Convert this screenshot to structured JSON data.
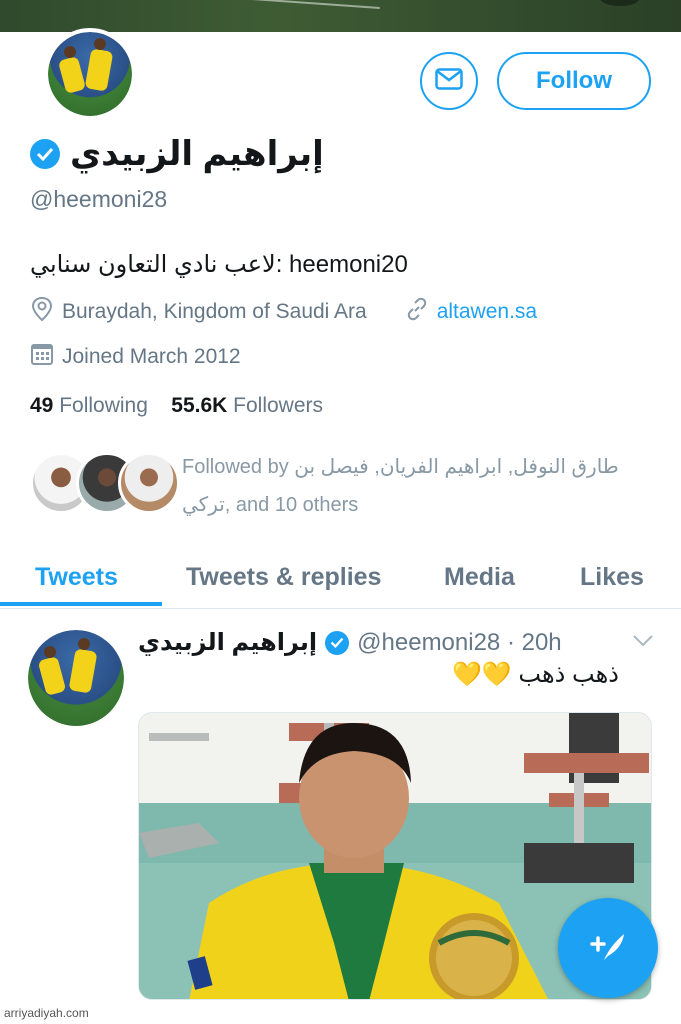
{
  "profile": {
    "name": "إبراهيم الزبيدي",
    "handle": "@heemoni28",
    "bio": "لاعب نادي التعاون سنابي: heemoni20",
    "location": "Buraydah, Kingdom of Saudi Ara",
    "website": "altawen.sa",
    "joined": "Joined March 2012",
    "following_count": "49",
    "following_label": "Following",
    "followers_count": "55.6K",
    "followers_label": "Followers",
    "followed_by": "Followed by طارق النوفل, ابراهيم الفريان, فيصل بن تركي, and 10 others",
    "follow_label": "Follow"
  },
  "tabs": [
    {
      "label": "Tweets",
      "active": true
    },
    {
      "label": "Tweets & replies",
      "active": false
    },
    {
      "label": "Media",
      "active": false
    },
    {
      "label": "Likes",
      "active": false
    }
  ],
  "tweet": {
    "name": "إبراهيم الزبيدي",
    "meta": "@heemoni28 · 20h",
    "text": "ذهب ذهب 💛💛"
  },
  "watermark": "arriyadiyah.com",
  "colors": {
    "accent": "#1da1f2",
    "muted": "#657786",
    "text": "#14171a"
  },
  "icons": [
    "mail-icon",
    "verified-icon",
    "location-pin-icon",
    "link-icon",
    "calendar-icon",
    "chevron-down-icon",
    "compose-tweet-icon"
  ]
}
